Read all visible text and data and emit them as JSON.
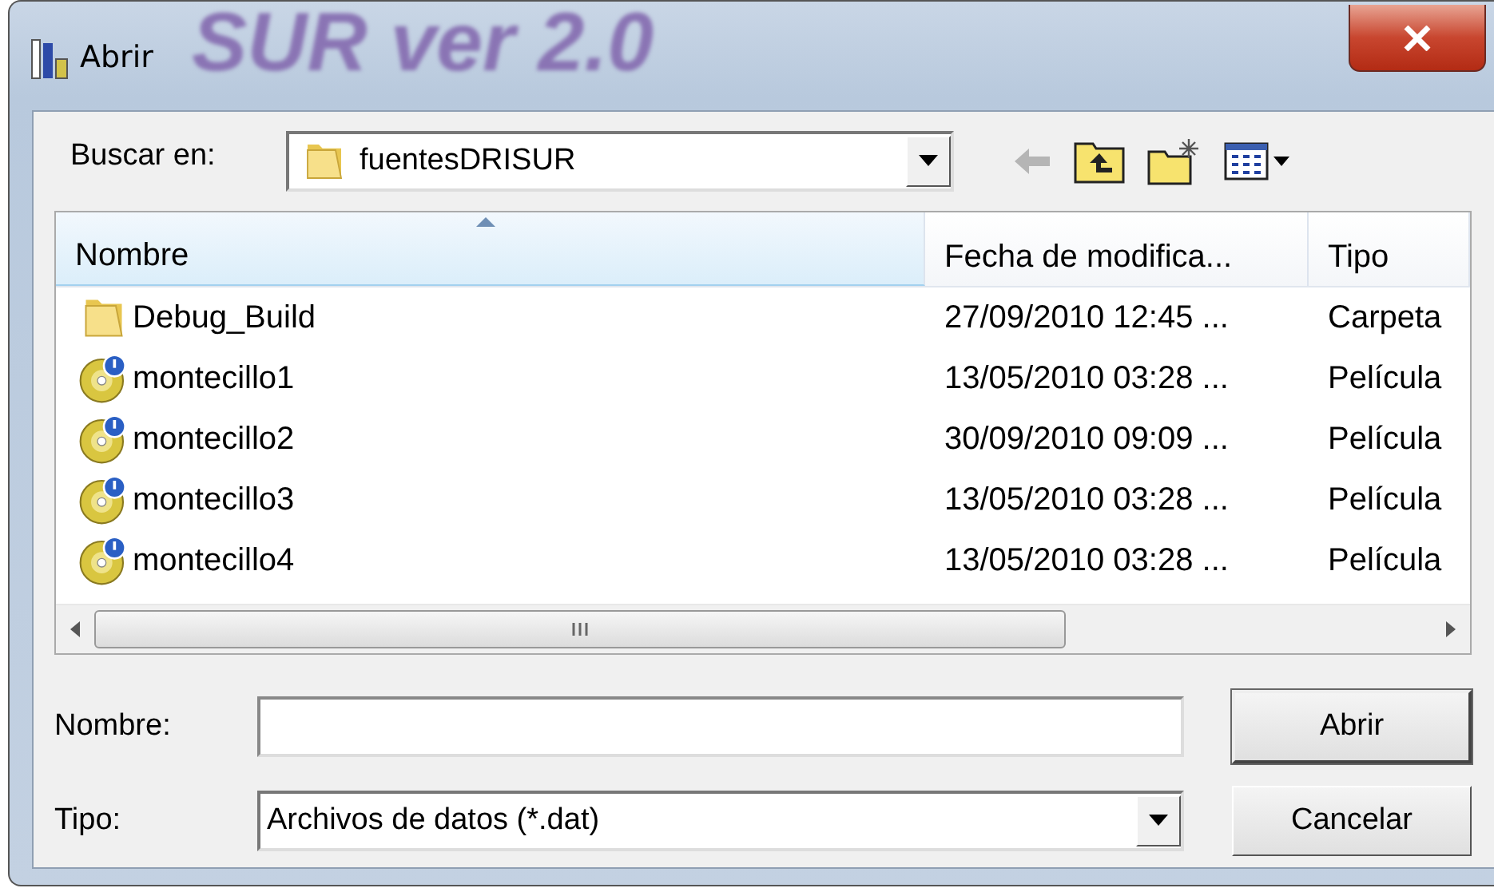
{
  "window": {
    "title": "Abrir",
    "background_title": "SUR ver 2.0"
  },
  "location": {
    "label": "Buscar en:",
    "value": "fuentesDRISUR"
  },
  "toolbar": [
    {
      "kind": "back",
      "disabled": true
    },
    {
      "kind": "up",
      "disabled": false
    },
    {
      "kind": "new-folder",
      "disabled": false
    },
    {
      "kind": "view-menu",
      "disabled": false
    }
  ],
  "table": {
    "columns": [
      {
        "label": "Nombre",
        "selected": true
      },
      {
        "label": "Fecha de modifica..."
      },
      {
        "label": "Tipo"
      }
    ],
    "rows": [
      {
        "kind": "folder",
        "name": "Debug_Build",
        "date": "27/09/2010 12:45  ...",
        "type": "Carpeta"
      },
      {
        "kind": "movie",
        "name": "montecillo1",
        "date": "13/05/2010 03:28  ...",
        "type": "Película"
      },
      {
        "kind": "movie",
        "name": "montecillo2",
        "date": "30/09/2010 09:09  ...",
        "type": "Película"
      },
      {
        "kind": "movie",
        "name": "montecillo3",
        "date": "13/05/2010 03:28  ...",
        "type": "Película"
      },
      {
        "kind": "movie",
        "name": "montecillo4",
        "date": "13/05/2010 03:28  ...",
        "type": "Película"
      }
    ]
  },
  "filename": {
    "label": "Nombre:"
  },
  "filetype": {
    "label": "Tipo:",
    "value": "Archivos de datos (*.dat)"
  },
  "buttons": [
    "Abrir",
    "Cancelar"
  ]
}
